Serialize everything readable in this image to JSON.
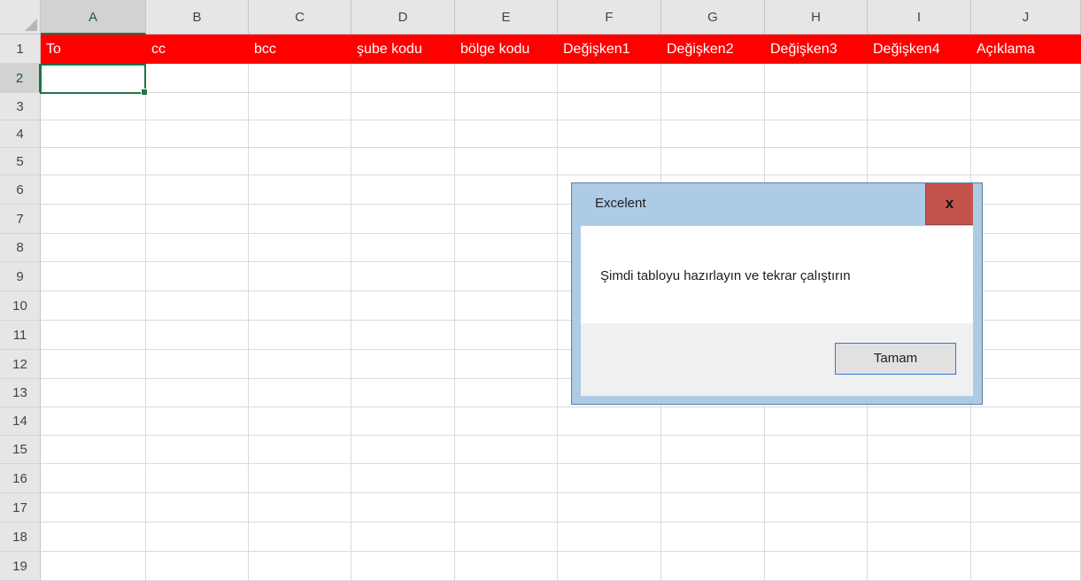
{
  "columns": [
    "A",
    "B",
    "C",
    "D",
    "E",
    "F",
    "G",
    "H",
    "I",
    "J"
  ],
  "rows": [
    "1",
    "2",
    "3",
    "4",
    "5",
    "6",
    "7",
    "8",
    "9",
    "10",
    "11",
    "12",
    "13",
    "14",
    "15",
    "16",
    "17",
    "18",
    "19"
  ],
  "header_row": [
    "To",
    "cc",
    "bcc",
    "şube kodu",
    "bölge kodu",
    "Değişken1",
    "Değişken2",
    "Değişken3",
    "Değişken4",
    "Açıklama"
  ],
  "selected_cell": "A2",
  "colors": {
    "header_fill": "#ff0000",
    "header_text": "#ffffff",
    "selection": "#217346",
    "dialog_frame": "#aecbe6",
    "close_button": "#c4544b"
  },
  "dialog": {
    "title": "Excelent",
    "close_label": "x",
    "message": "Şimdi tabloyu hazırlayın ve tekrar çalıştırın",
    "ok_label": "Tamam"
  }
}
